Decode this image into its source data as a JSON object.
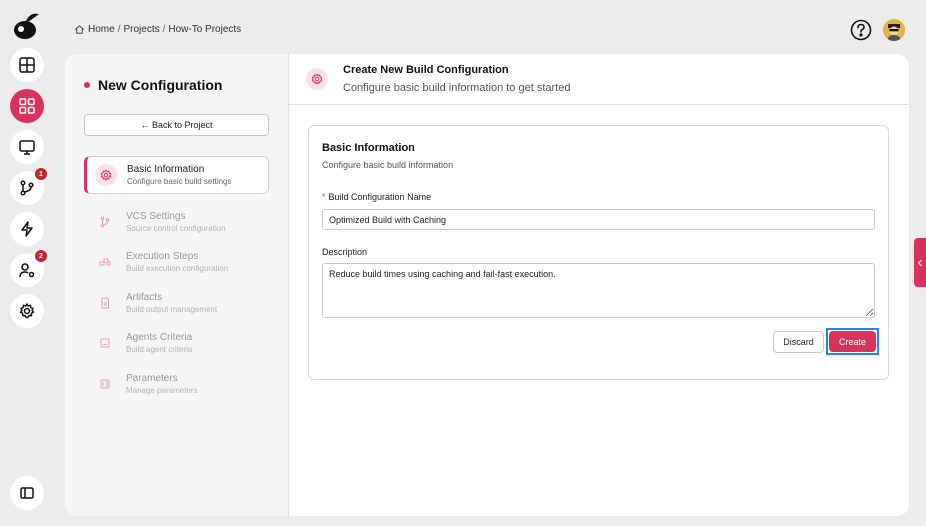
{
  "breadcrumb": {
    "items": [
      "Home",
      "Projects",
      "How-To Projects"
    ],
    "separator": "/"
  },
  "sidebar": {
    "items": [
      {
        "name": "dashboard",
        "icon": "layout-grid-icon"
      },
      {
        "name": "apps",
        "icon": "apps-grid-icon",
        "active": true
      },
      {
        "name": "monitor",
        "icon": "monitor-icon"
      },
      {
        "name": "source-control",
        "icon": "git-branch-icon",
        "badge": "1"
      },
      {
        "name": "automation",
        "icon": "lightning-icon"
      },
      {
        "name": "user-settings",
        "icon": "user-gear-icon",
        "badge": "2"
      },
      {
        "name": "settings",
        "icon": "gear-icon"
      },
      {
        "name": "collapse",
        "icon": "sidebar-panel-icon"
      }
    ]
  },
  "config": {
    "title": "New Configuration",
    "back_label": "← Back to Project",
    "steps": [
      {
        "title": "Basic Information",
        "subtitle": "Configure basic build settings",
        "icon": "gear-icon",
        "active": true
      },
      {
        "title": "VCS Settings",
        "subtitle": "Source control configuration",
        "icon": "git-branch-icon"
      },
      {
        "title": "Execution Steps",
        "subtitle": "Build execution configuration",
        "icon": "steps-icon"
      },
      {
        "title": "Artifacts",
        "subtitle": "Build output management",
        "icon": "file-icon"
      },
      {
        "title": "Agents Criteria",
        "subtitle": "Build agent criteria",
        "icon": "agent-icon"
      },
      {
        "title": "Parameters",
        "subtitle": "Manage parameters",
        "icon": "parameters-icon"
      }
    ]
  },
  "main": {
    "header_title": "Create New Build Configuration",
    "header_subtitle": "Configure basic build information to get started",
    "section_title": "Basic Information",
    "section_subtitle": "Configure basic build information",
    "name_label": "Build Configuration Name",
    "required_mark": "*",
    "name_value": "Optimized Build with Caching",
    "description_label": "Description",
    "description_value": "Reduce build times using caching and fail-fast execution.",
    "discard_label": "Discard",
    "create_label": "Create"
  },
  "colors": {
    "accent": "#d8335f",
    "focus": "#1e88e5"
  }
}
